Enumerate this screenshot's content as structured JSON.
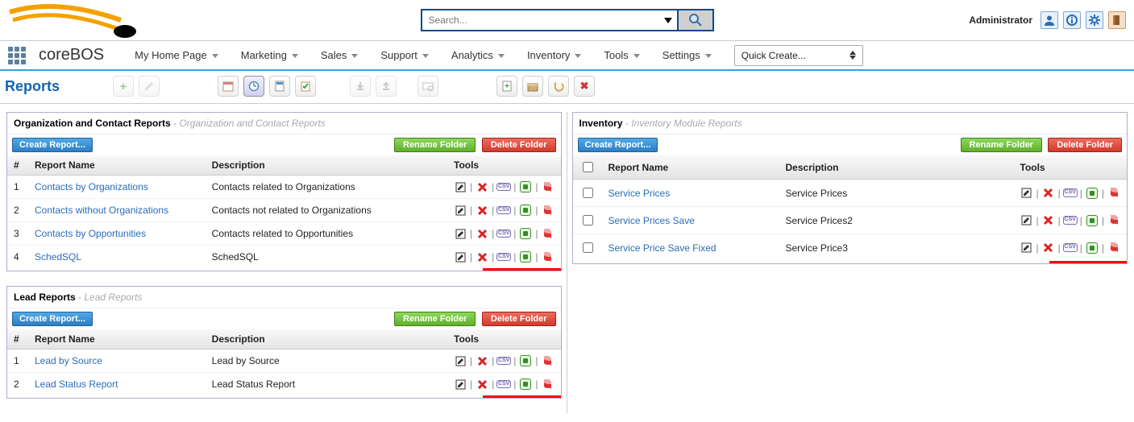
{
  "top": {
    "admin_label": "Administrator",
    "search_placeholder": "Search..."
  },
  "brand": "coreBOS",
  "nav": {
    "items": [
      "My Home Page",
      "Marketing",
      "Sales",
      "Support",
      "Analytics",
      "Inventory",
      "Tools",
      "Settings"
    ],
    "quick_create": "Quick Create..."
  },
  "page_title": "Reports",
  "labels": {
    "create_report": "Create Report...",
    "rename_folder": "Rename Folder",
    "delete_folder": "Delete Folder",
    "col_num": "#",
    "col_name": "Report Name",
    "col_desc": "Description",
    "col_tools": "Tools"
  },
  "panels": [
    {
      "id": "org-contact",
      "title": "Organization and Contact Reports",
      "subtitle": "Organization and Contact Reports",
      "numbered": true,
      "redline": true,
      "rows": [
        {
          "n": "1",
          "name": "Contacts by Organizations",
          "desc": "Contacts related to Organizations"
        },
        {
          "n": "2",
          "name": "Contacts without Organizations",
          "desc": "Contacts not related to Organizations"
        },
        {
          "n": "3",
          "name": "Contacts by Opportunities",
          "desc": "Contacts related to Opportunities"
        },
        {
          "n": "4",
          "name": "SchedSQL",
          "desc": "SchedSQL"
        }
      ]
    },
    {
      "id": "lead",
      "title": "Lead Reports",
      "subtitle": "Lead Reports",
      "numbered": true,
      "redline": true,
      "rows": [
        {
          "n": "1",
          "name": "Lead by Source",
          "desc": "Lead by Source"
        },
        {
          "n": "2",
          "name": "Lead Status Report",
          "desc": "Lead Status Report"
        }
      ]
    },
    {
      "id": "inventory",
      "title": "Inventory",
      "subtitle": "Inventory Module Reports",
      "numbered": false,
      "redline": true,
      "rows": [
        {
          "name": "Service Prices",
          "desc": "Service Prices"
        },
        {
          "name": "Service Prices Save",
          "desc": "Service Prices2"
        },
        {
          "name": "Service Price Save Fixed",
          "desc": "Service Price3"
        }
      ]
    }
  ]
}
